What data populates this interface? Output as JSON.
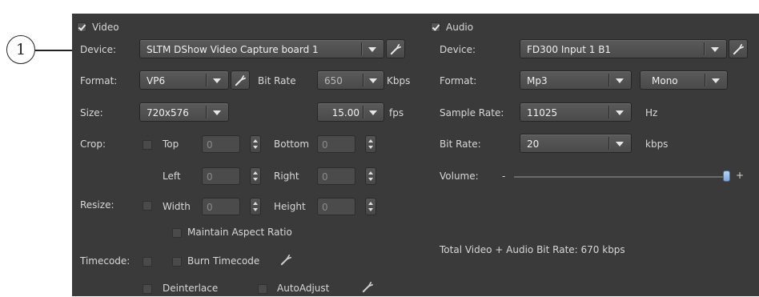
{
  "callout": {
    "number": "1"
  },
  "video": {
    "title": "Video",
    "enabled": true,
    "device_label": "Device:",
    "device_value": "SLTM DShow  Video Capture board 1",
    "format_label": "Format:",
    "format_value": "VP6",
    "bitrate_label": "Bit Rate",
    "bitrate_value": "650",
    "bitrate_unit": "Kbps",
    "size_label": "Size:",
    "size_value": "720x576",
    "fps_value": "15.00",
    "fps_unit": "fps",
    "crop_label": "Crop:",
    "crop_enabled": false,
    "crop_top_label": "Top",
    "crop_top_value": "0",
    "crop_bottom_label": "Bottom",
    "crop_bottom_value": "0",
    "crop_left_label": "Left",
    "crop_left_value": "0",
    "crop_right_label": "Right",
    "crop_right_value": "0",
    "resize_label": "Resize:",
    "resize_enabled": false,
    "resize_width_label": "Width",
    "resize_width_value": "0",
    "resize_height_label": "Height",
    "resize_height_value": "0",
    "maintain_aspect_label": "Maintain Aspect Ratio",
    "timecode_label": "Timecode:",
    "burn_timecode_label": "Burn Timecode",
    "deinterlace_label": "Deinterlace",
    "autoadjust_label": "AutoAdjust"
  },
  "audio": {
    "title": "Audio",
    "enabled": true,
    "device_label": "Device:",
    "device_value": "FD300 Input 1 B1",
    "format_label": "Format:",
    "format_value": "Mp3",
    "channels_value": "Mono",
    "sample_rate_label": "Sample Rate:",
    "sample_rate_value": "11025",
    "sample_rate_unit": "Hz",
    "bitrate_label": "Bit Rate:",
    "bitrate_value": "20",
    "bitrate_unit": "kbps",
    "volume_label": "Volume:",
    "volume_minus": "-",
    "volume_plus": "+",
    "volume_level": 1.0,
    "total_bitrate_text": "Total Video + Audio Bit Rate: 670 kbps"
  },
  "colors": {
    "panel": "#3a3a3a",
    "text": "#d8d8d8",
    "control": "#4f4f4f",
    "slider_thumb": "#8fb7e8"
  },
  "icons": [
    "wrench-icon",
    "chevron-down-icon",
    "spin-up-icon",
    "spin-down-icon",
    "checkmark-icon"
  ]
}
